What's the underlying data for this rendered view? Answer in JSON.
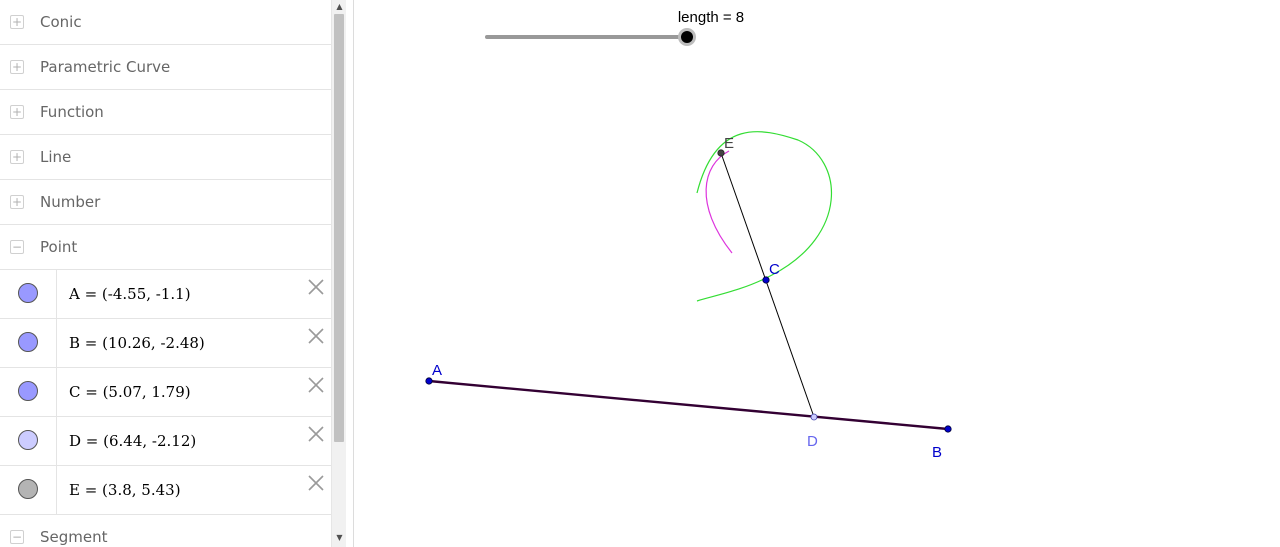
{
  "algebra": {
    "groups": [
      {
        "label": "Conic",
        "expanded": false
      },
      {
        "label": "Parametric Curve",
        "expanded": false
      },
      {
        "label": "Function",
        "expanded": false
      },
      {
        "label": "Line",
        "expanded": false
      },
      {
        "label": "Number",
        "expanded": false
      },
      {
        "label": "Point",
        "expanded": true
      }
    ],
    "points": [
      {
        "text": "A = (-4.55, -1.1)",
        "color": "#9999ff"
      },
      {
        "text": "B = (10.26, -2.48)",
        "color": "#9999ff"
      },
      {
        "text": "C = (5.07, 1.79)",
        "color": "#9999ff"
      },
      {
        "text": "D = (6.44, -2.12)",
        "color": "#ccccff"
      },
      {
        "text": "E = (3.8, 5.43)",
        "color": "#b4b4b4"
      }
    ],
    "trailing_group": {
      "label": "Segment",
      "expanded": true
    }
  },
  "slider": {
    "label": "length = 8"
  },
  "points": {
    "A": {
      "label": "A",
      "color": "#0000cc"
    },
    "B": {
      "label": "B",
      "color": "#0000cc"
    },
    "C": {
      "label": "C",
      "color": "#0000cc"
    },
    "D": {
      "label": "D",
      "color": "#6666ee"
    },
    "E": {
      "label": "E",
      "color": "#444444"
    }
  },
  "colors": {
    "segment": "#330033",
    "linkage": "#000000",
    "curve_green": "#33dd33",
    "curve_magenta": "#dd33dd",
    "slider_track": "#999999",
    "slider_knob": "#000000"
  },
  "icons": {
    "expand": "plus-icon",
    "collapse": "minus-icon",
    "delete": "close-icon"
  }
}
